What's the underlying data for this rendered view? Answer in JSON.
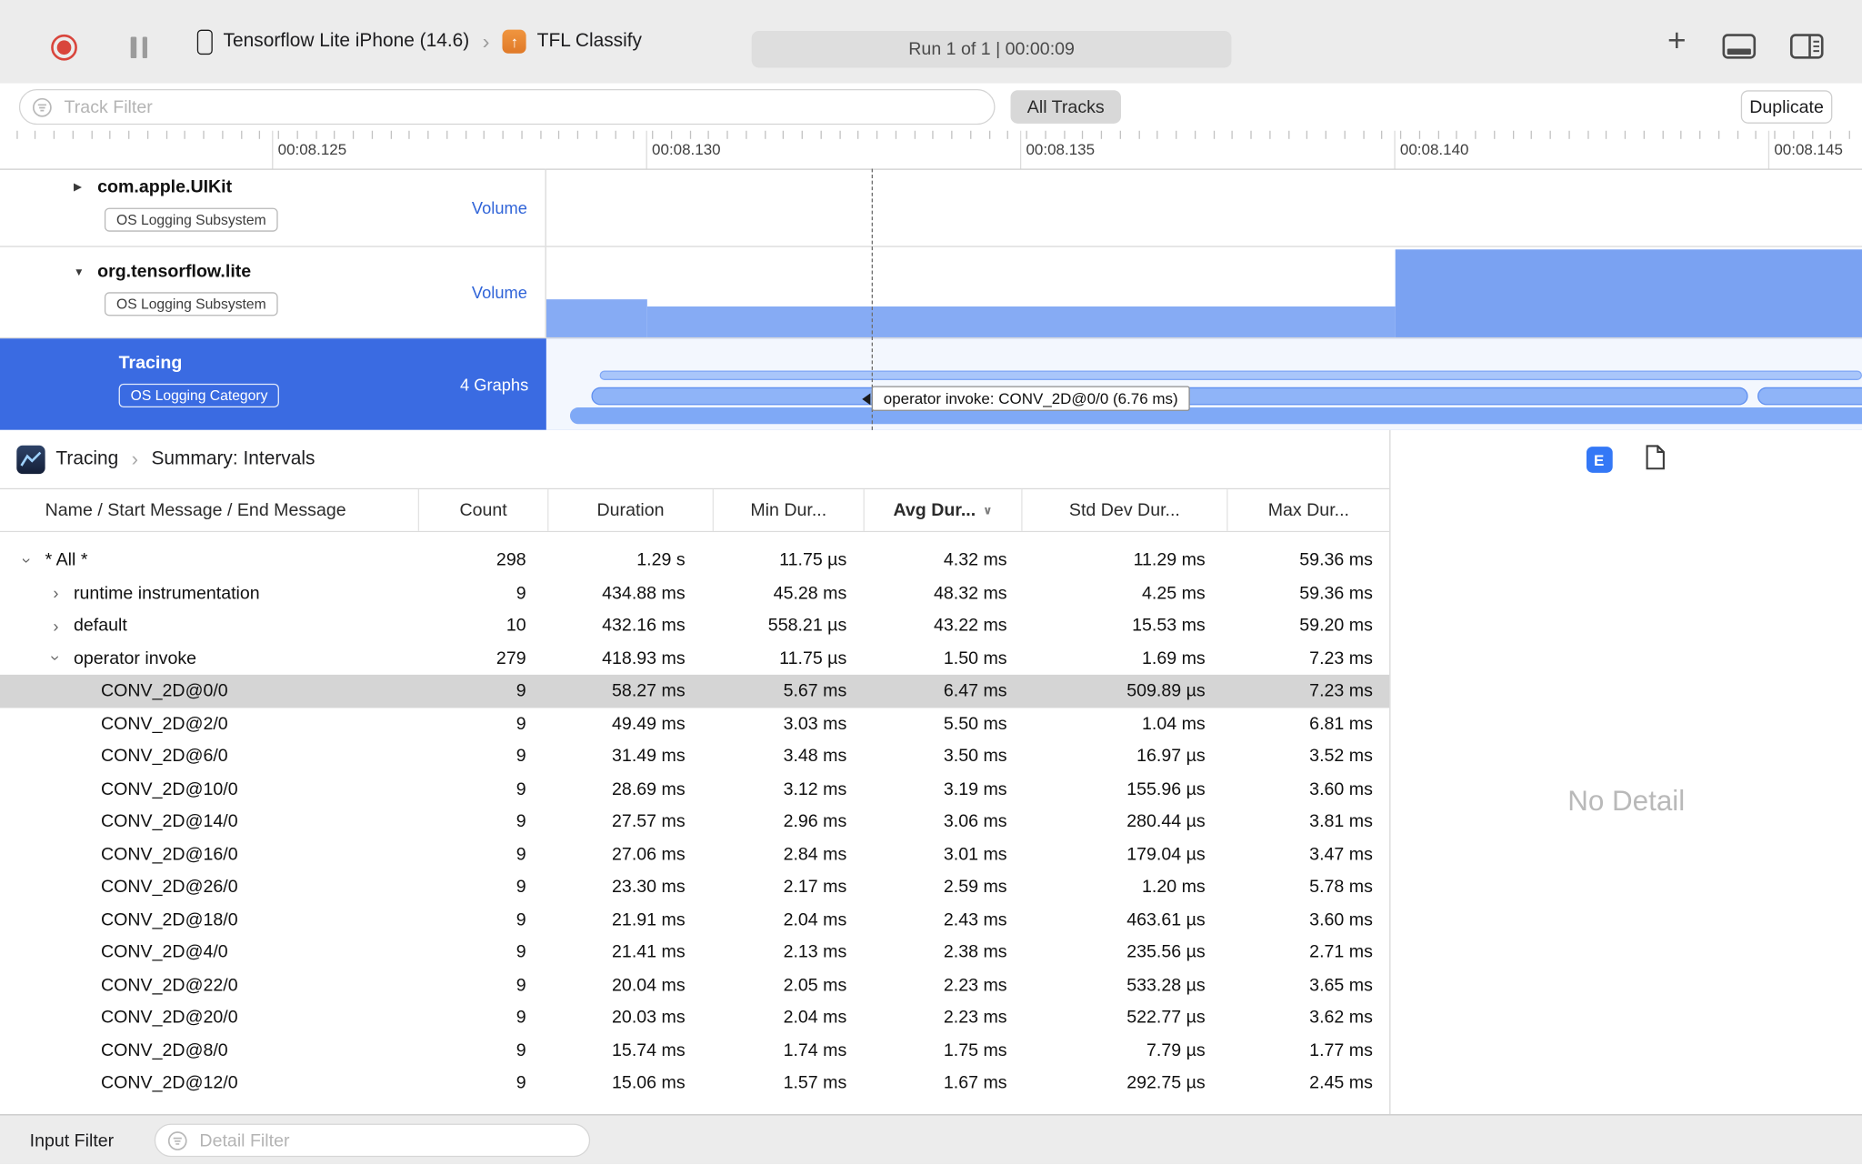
{
  "toolbar": {
    "device_name": "Tensorflow Lite iPhone (14.6)",
    "target_name": "TFL Classify",
    "run_status": "Run 1 of 1   |   00:00:09",
    "accent_blue": "#3478f6",
    "record_red": "#d9453c"
  },
  "filter_bar": {
    "track_filter_placeholder": "Track Filter",
    "all_tracks": "All Tracks",
    "duplicate": "Duplicate"
  },
  "ruler": {
    "labels": [
      "00:08.125",
      "00:08.130",
      "00:08.135",
      "00:08.140",
      "00:08.145"
    ]
  },
  "tracks": [
    {
      "name": "com.apple.UIKit",
      "badge": "OS Logging Subsystem",
      "meta": "Volume",
      "disclosure": "collapsed"
    },
    {
      "name": "org.tensorflow.lite",
      "badge": "OS Logging Subsystem",
      "meta": "Volume",
      "disclosure": "expanded"
    },
    {
      "name": "Tracing",
      "badge": "OS Logging Category",
      "meta": "4 Graphs",
      "selected": true
    }
  ],
  "timeline_tooltip": "operator invoke: CONV_2D@0/0 (6.76 ms)",
  "detail": {
    "breadcrumb": {
      "root": "Tracing",
      "page": "Summary: Intervals"
    },
    "inspector_badge": "E",
    "no_detail": "No Detail",
    "table": {
      "columns": {
        "name": "Name / Start Message / End Message",
        "count": "Count",
        "duration": "Duration",
        "min": "Min Dur...",
        "avg": "Avg Dur...",
        "std": "Std Dev Dur...",
        "max": "Max Dur..."
      },
      "rows": [
        {
          "name": "* All *",
          "count": "298",
          "duration": "1.29 s",
          "min": "11.75 µs",
          "avg": "4.32 ms",
          "std": "11.29 ms",
          "max": "59.36 ms",
          "indent": 0,
          "disclosure": "expanded",
          "selected": false
        },
        {
          "name": "runtime instrumentation",
          "count": "9",
          "duration": "434.88 ms",
          "min": "45.28 ms",
          "avg": "48.32 ms",
          "std": "4.25 ms",
          "max": "59.36 ms",
          "indent": 1,
          "disclosure": "collapsed",
          "selected": false
        },
        {
          "name": "default",
          "count": "10",
          "duration": "432.16 ms",
          "min": "558.21 µs",
          "avg": "43.22 ms",
          "std": "15.53 ms",
          "max": "59.20 ms",
          "indent": 1,
          "disclosure": "collapsed",
          "selected": false
        },
        {
          "name": "operator invoke",
          "count": "279",
          "duration": "418.93 ms",
          "min": "11.75 µs",
          "avg": "1.50 ms",
          "std": "1.69 ms",
          "max": "7.23 ms",
          "indent": 1,
          "disclosure": "expanded",
          "selected": false
        },
        {
          "name": "CONV_2D@0/0",
          "count": "9",
          "duration": "58.27 ms",
          "min": "5.67 ms",
          "avg": "6.47 ms",
          "std": "509.89 µs",
          "max": "7.23 ms",
          "indent": 2,
          "disclosure": null,
          "selected": true
        },
        {
          "name": "CONV_2D@2/0",
          "count": "9",
          "duration": "49.49 ms",
          "min": "3.03 ms",
          "avg": "5.50 ms",
          "std": "1.04 ms",
          "max": "6.81 ms",
          "indent": 2,
          "disclosure": null,
          "selected": false
        },
        {
          "name": "CONV_2D@6/0",
          "count": "9",
          "duration": "31.49 ms",
          "min": "3.48 ms",
          "avg": "3.50 ms",
          "std": "16.97 µs",
          "max": "3.52 ms",
          "indent": 2,
          "disclosure": null,
          "selected": false
        },
        {
          "name": "CONV_2D@10/0",
          "count": "9",
          "duration": "28.69 ms",
          "min": "3.12 ms",
          "avg": "3.19 ms",
          "std": "155.96 µs",
          "max": "3.60 ms",
          "indent": 2,
          "disclosure": null,
          "selected": false
        },
        {
          "name": "CONV_2D@14/0",
          "count": "9",
          "duration": "27.57 ms",
          "min": "2.96 ms",
          "avg": "3.06 ms",
          "std": "280.44 µs",
          "max": "3.81 ms",
          "indent": 2,
          "disclosure": null,
          "selected": false
        },
        {
          "name": "CONV_2D@16/0",
          "count": "9",
          "duration": "27.06 ms",
          "min": "2.84 ms",
          "avg": "3.01 ms",
          "std": "179.04 µs",
          "max": "3.47 ms",
          "indent": 2,
          "disclosure": null,
          "selected": false
        },
        {
          "name": "CONV_2D@26/0",
          "count": "9",
          "duration": "23.30 ms",
          "min": "2.17 ms",
          "avg": "2.59 ms",
          "std": "1.20 ms",
          "max": "5.78 ms",
          "indent": 2,
          "disclosure": null,
          "selected": false
        },
        {
          "name": "CONV_2D@18/0",
          "count": "9",
          "duration": "21.91 ms",
          "min": "2.04 ms",
          "avg": "2.43 ms",
          "std": "463.61 µs",
          "max": "3.60 ms",
          "indent": 2,
          "disclosure": null,
          "selected": false
        },
        {
          "name": "CONV_2D@4/0",
          "count": "9",
          "duration": "21.41 ms",
          "min": "2.13 ms",
          "avg": "2.38 ms",
          "std": "235.56 µs",
          "max": "2.71 ms",
          "indent": 2,
          "disclosure": null,
          "selected": false
        },
        {
          "name": "CONV_2D@22/0",
          "count": "9",
          "duration": "20.04 ms",
          "min": "2.05 ms",
          "avg": "2.23 ms",
          "std": "533.28 µs",
          "max": "3.65 ms",
          "indent": 2,
          "disclosure": null,
          "selected": false
        },
        {
          "name": "CONV_2D@20/0",
          "count": "9",
          "duration": "20.03 ms",
          "min": "2.04 ms",
          "avg": "2.23 ms",
          "std": "522.77 µs",
          "max": "3.62 ms",
          "indent": 2,
          "disclosure": null,
          "selected": false
        },
        {
          "name": "CONV_2D@8/0",
          "count": "9",
          "duration": "15.74 ms",
          "min": "1.74 ms",
          "avg": "1.75 ms",
          "std": "7.79 µs",
          "max": "1.77 ms",
          "indent": 2,
          "disclosure": null,
          "selected": false
        },
        {
          "name": "CONV_2D@12/0",
          "count": "9",
          "duration": "15.06 ms",
          "min": "1.57 ms",
          "avg": "1.67 ms",
          "std": "292.75 µs",
          "max": "2.45 ms",
          "indent": 2,
          "disclosure": null,
          "selected": false
        }
      ]
    }
  },
  "status_bar": {
    "input_filter": "Input Filter",
    "detail_filter_placeholder": "Detail Filter"
  }
}
